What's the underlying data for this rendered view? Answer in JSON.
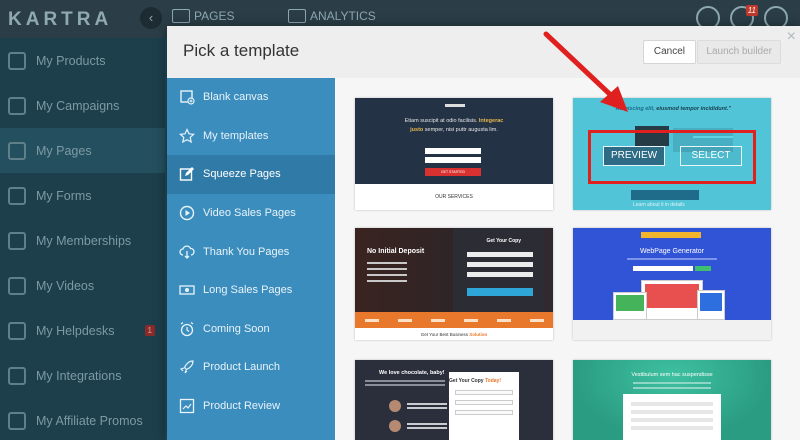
{
  "app": {
    "logo": "KARTRA",
    "collapse_icon": "‹",
    "tabs": [
      {
        "label": "PAGES",
        "icon": "pages-icon"
      },
      {
        "label": "ANALYTICS",
        "icon": "analytics-icon"
      }
    ],
    "notification_count": "11",
    "nav": [
      {
        "label": "My Products",
        "icon": "products-icon"
      },
      {
        "label": "My Campaigns",
        "icon": "campaigns-icon"
      },
      {
        "label": "My Pages",
        "icon": "pages-icon",
        "active": true
      },
      {
        "label": "My Forms",
        "icon": "forms-icon"
      },
      {
        "label": "My Memberships",
        "icon": "memberships-icon"
      },
      {
        "label": "My Videos",
        "icon": "videos-icon"
      },
      {
        "label": "My Helpdesks",
        "icon": "helpdesks-icon",
        "badge": "1"
      },
      {
        "label": "My Integrations",
        "icon": "integrations-icon"
      },
      {
        "label": "My Affiliate Promos",
        "icon": "affiliate-icon"
      }
    ]
  },
  "modal": {
    "title": "Pick a template",
    "close": "×",
    "cancel_label": "Cancel",
    "launch_label": "Launch builder",
    "categories": [
      {
        "label": "Blank canvas",
        "icon": "blank-canvas-icon"
      },
      {
        "label": "My templates",
        "icon": "star-icon"
      },
      {
        "label": "Squeeze Pages",
        "icon": "edit-icon",
        "active": true
      },
      {
        "label": "Video Sales Pages",
        "icon": "play-icon"
      },
      {
        "label": "Thank You Pages",
        "icon": "cloud-download-icon"
      },
      {
        "label": "Long Sales Pages",
        "icon": "money-icon"
      },
      {
        "label": "Coming Soon",
        "icon": "alarm-clock-icon"
      },
      {
        "label": "Product Launch",
        "icon": "rocket-icon"
      },
      {
        "label": "Product Review",
        "icon": "chart-icon"
      }
    ],
    "templates": {
      "t1": {
        "line1": "Etiam suscipit at odio facilisis.",
        "highlight": "Integerac",
        "line2a": "justo",
        "line2b": "semper, nisi puttr augusta lim.",
        "button": "GET STARTED",
        "footer": "OUR SERVICES"
      },
      "t2": {
        "headline_a": "\"Adipiscing elit,",
        "headline_b": "eiusmod tempor incididunt.\"",
        "cta": "Learn about it in details",
        "preview_label": "PREVIEW",
        "select_label": "SELECT"
      },
      "t3": {
        "title": "No Initial Deposit",
        "form_title": "Get Your Copy",
        "footer_a": "Get Your Best Business",
        "footer_b": "Solution"
      },
      "t4": {
        "title": "WebPage Generator"
      },
      "t5": {
        "title": "We love chocolate, baby!",
        "form_title_a": "Get Your Copy",
        "form_title_b": "Today!"
      },
      "t6": {
        "title": "Vestibulum sem hac suspendisse"
      }
    }
  },
  "colors": {
    "sidebar_blue": "#3b8dbd",
    "sidebar_active": "#2f7aa6",
    "highlight_red": "#e0201e",
    "arrow_red": "#e0201e"
  }
}
